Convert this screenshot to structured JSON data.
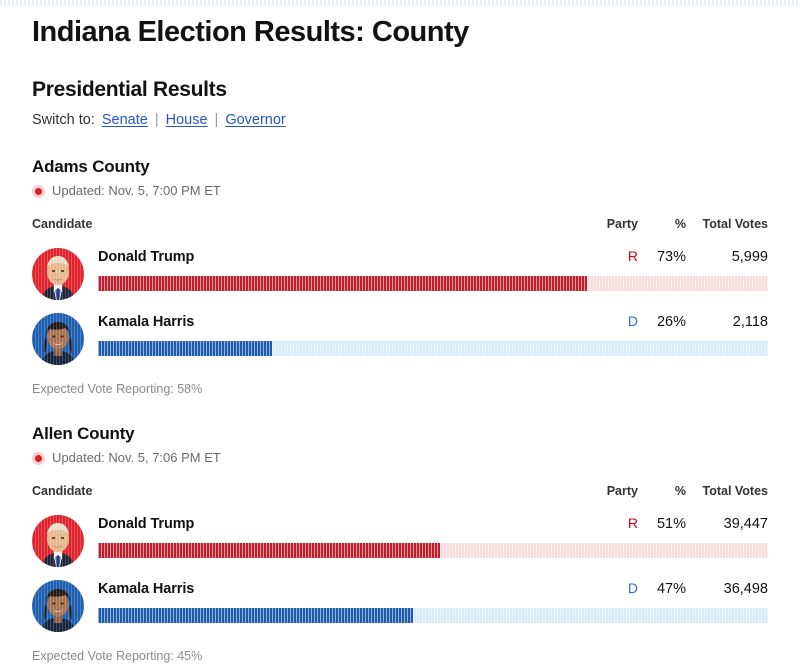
{
  "page": {
    "title": "Indiana Election Results: County",
    "section_heading": "Presidential Results"
  },
  "switch": {
    "label": "Switch to:",
    "separator": "|",
    "links": [
      {
        "label": "Senate"
      },
      {
        "label": "House"
      },
      {
        "label": "Governor"
      }
    ]
  },
  "table_headers": {
    "candidate": "Candidate",
    "party": "Party",
    "percent": "%",
    "total_votes": "Total Votes"
  },
  "colors": {
    "republican": "#bd1f2d",
    "republican_track": "#f7dcdc",
    "republican_text": "#d0021b",
    "democrat": "#1a5cab",
    "democrat_track": "#d7ecfa",
    "democrat_text": "#2e6ed1",
    "link": "#2558c4",
    "live_dot": "#d81f28"
  },
  "counties": [
    {
      "name": "Adams County",
      "updated": "Updated: Nov. 5, 7:00 PM ET",
      "reporting": "Expected Vote Reporting: 58%",
      "candidates": [
        {
          "name": "Donald Trump",
          "party": "R",
          "percent": "73%",
          "percent_value": 73,
          "votes": "5,999",
          "avatar": "donald-trump-avatar"
        },
        {
          "name": "Kamala Harris",
          "party": "D",
          "percent": "26%",
          "percent_value": 26,
          "votes": "2,118",
          "avatar": "kamala-harris-avatar"
        }
      ]
    },
    {
      "name": "Allen County",
      "updated": "Updated: Nov. 5, 7:06 PM ET",
      "reporting": "Expected Vote Reporting: 45%",
      "candidates": [
        {
          "name": "Donald Trump",
          "party": "R",
          "percent": "51%",
          "percent_value": 51,
          "votes": "39,447",
          "avatar": "donald-trump-avatar"
        },
        {
          "name": "Kamala Harris",
          "party": "D",
          "percent": "47%",
          "percent_value": 47,
          "votes": "36,498",
          "avatar": "kamala-harris-avatar"
        }
      ]
    }
  ]
}
